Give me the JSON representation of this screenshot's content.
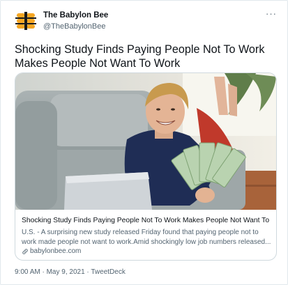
{
  "author": {
    "name": "The Babylon Bee",
    "handle": "@TheBabylonBee",
    "avatar_icon": "babylon-bee-logo",
    "logo_color": "#f6a623"
  },
  "more_label": "···",
  "tweet": {
    "text": "Shocking Study Finds Paying People Not To Work Makes People Not Want To Work"
  },
  "link_card": {
    "image_icon": "smiling-man-with-cash-photo",
    "title": "Shocking Study Finds Paying People Not To Work Makes People Not Want To ...",
    "description": "U.S. - A surprising new study released Friday found that paying people not to work made people not want to work.Amid shockingly low job numbers released...",
    "domain": "babylonbee.com",
    "domain_icon": "link-icon"
  },
  "meta": {
    "time": "9:00 AM",
    "separator": " · ",
    "date": "May 9, 2021",
    "source": "TweetDeck"
  }
}
